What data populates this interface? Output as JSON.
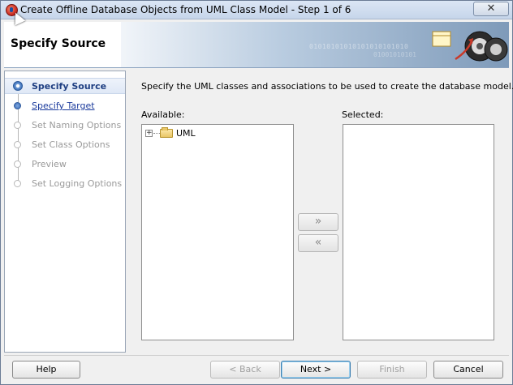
{
  "window": {
    "title": "Create Offline Database Objects from UML Class Model - Step 1 of 6",
    "close_glyph": "✕"
  },
  "banner": {
    "title": "Specify Source",
    "binary_text": "01010101010101010101010",
    "binary_text2": "01001010101"
  },
  "nav": {
    "items": [
      {
        "label": "Specify Source",
        "state": "active"
      },
      {
        "label": "Specify Target",
        "state": "link"
      },
      {
        "label": "Set Naming Options",
        "state": "disabled"
      },
      {
        "label": "Set Class Options",
        "state": "disabled"
      },
      {
        "label": "Preview",
        "state": "disabled"
      },
      {
        "label": "Set Logging Options",
        "state": "disabled"
      }
    ]
  },
  "main": {
    "instructions": "Specify the UML classes and associations to be used to create the database model.",
    "available_label": "Available:",
    "selected_label": "Selected:",
    "available_tree": [
      {
        "label": "UML",
        "expander": "+"
      }
    ],
    "add_glyph": "»",
    "remove_glyph": "«"
  },
  "buttons": {
    "help": "Help",
    "back": "< Back",
    "next": "Next >",
    "finish": "Finish",
    "cancel": "Cancel"
  },
  "colors": {
    "active_step": "#1f3f82",
    "link_step": "#1a3a9c",
    "disabled_step": "#9a9a9a"
  }
}
